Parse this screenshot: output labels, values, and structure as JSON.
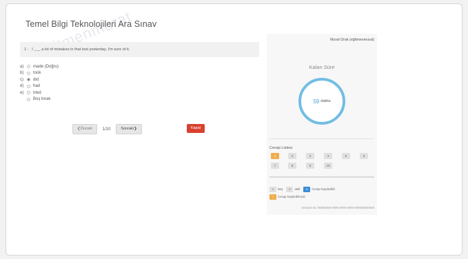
{
  "exam": {
    "title": "Temel Bilgi Teknolojileri Ara Sınav",
    "watermark": "eğitmenmurat",
    "question": {
      "number": "1 -",
      "text": "I ___ a lot of mistakes in that test yesterday, I'm sure of it."
    },
    "options": [
      {
        "letter": "a)",
        "text": "made (Doğru)",
        "checked": false
      },
      {
        "letter": "b)",
        "text": "took",
        "checked": false
      },
      {
        "letter": "c)",
        "text": "did",
        "checked": true
      },
      {
        "letter": "d)",
        "text": "had",
        "checked": false
      },
      {
        "letter": "e)",
        "text": "tried",
        "checked": false
      },
      {
        "letter": "",
        "text": "Boş bırak",
        "checked": false
      }
    ],
    "nav": {
      "prev": "❮Önceki",
      "page": "1/10",
      "next": "Sonraki❯",
      "close": "Kapat"
    }
  },
  "panel": {
    "user": "Murat Orak (eğitmenmurat)",
    "timer_label": "Kalan Süre",
    "timer_value": "59",
    "timer_unit": "dakika",
    "answer_list_title": "Cevap Listesi",
    "answers": [
      "1",
      "2",
      "3",
      "4",
      "5",
      "6",
      "7",
      "8",
      "9",
      "10"
    ],
    "current_answer": "1",
    "legend": [
      {
        "swatch": "4",
        "text": "Boş",
        "swatch2": "5",
        "text2": "aktif",
        "swatch3": "6",
        "text3": "Cevap Kaydedildi"
      },
      {
        "swatch": "7",
        "text": "Cevap Kaydedilmedi"
      }
    ],
    "session": "Session ID: 00000000-0000-0000-0000-000000000000"
  },
  "colors": {
    "accent_blue": "#72bde3",
    "close_red": "#d9412f",
    "current_orange": "#f0ad4e",
    "saved_blue": "#3c8dd6"
  }
}
